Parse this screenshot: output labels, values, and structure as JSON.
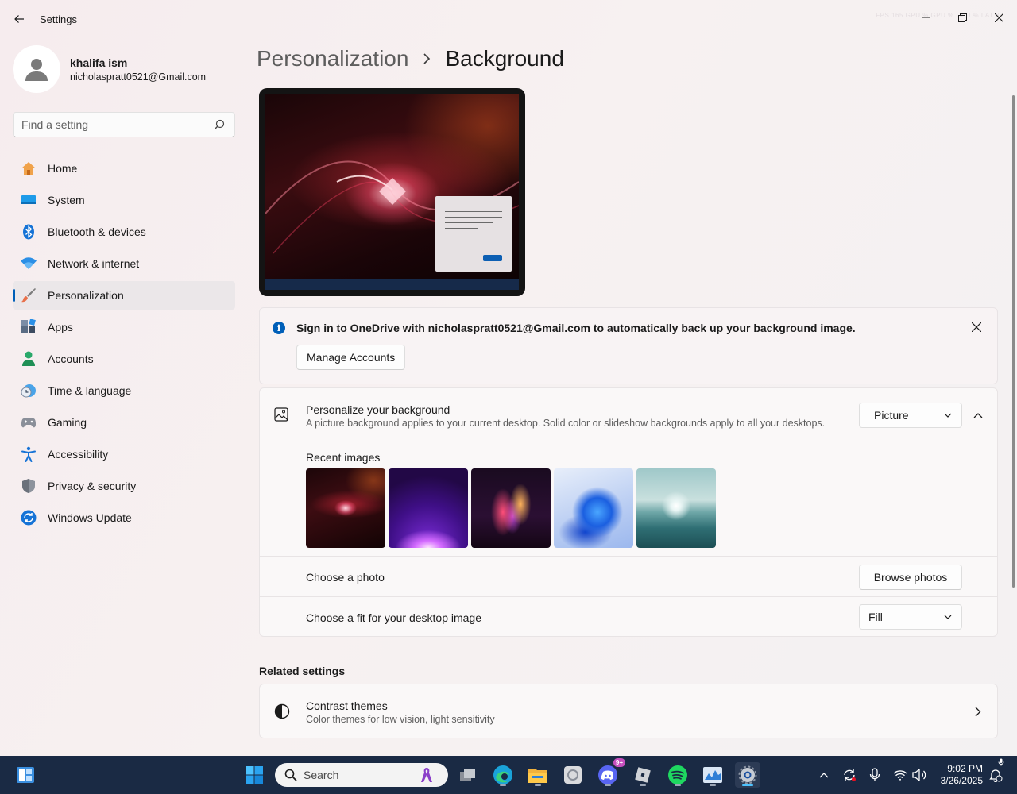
{
  "window": {
    "title": "Settings",
    "overlay": "FPS 165 GPU % GPU % CPU % LAT 8"
  },
  "profile": {
    "name": "khalifa ism",
    "email": "nicholaspratt0521@Gmail.com"
  },
  "search": {
    "placeholder": "Find a setting"
  },
  "sidebar": {
    "items": [
      {
        "label": "Home",
        "icon": "home-icon"
      },
      {
        "label": "System",
        "icon": "system-icon"
      },
      {
        "label": "Bluetooth & devices",
        "icon": "bluetooth-icon"
      },
      {
        "label": "Network & internet",
        "icon": "wifi-icon"
      },
      {
        "label": "Personalization",
        "icon": "brush-icon",
        "active": true
      },
      {
        "label": "Apps",
        "icon": "apps-icon"
      },
      {
        "label": "Accounts",
        "icon": "accounts-icon"
      },
      {
        "label": "Time & language",
        "icon": "clock-globe-icon"
      },
      {
        "label": "Gaming",
        "icon": "gamepad-icon"
      },
      {
        "label": "Accessibility",
        "icon": "accessibility-icon"
      },
      {
        "label": "Privacy & security",
        "icon": "shield-icon"
      },
      {
        "label": "Windows Update",
        "icon": "update-icon"
      }
    ]
  },
  "breadcrumb": {
    "parent": "Personalization",
    "current": "Background"
  },
  "banner": {
    "text": "Sign in to OneDrive with nicholaspratt0521@Gmail.com to automatically back up your background image.",
    "button": "Manage Accounts"
  },
  "personalize": {
    "title": "Personalize your background",
    "description": "A picture background applies to your current desktop. Solid color or slideshow backgrounds apply to all your desktops.",
    "selected": "Picture",
    "recent_label": "Recent images",
    "choose_photo": "Choose a photo",
    "browse_button": "Browse photos",
    "fit_label": "Choose a fit for your desktop image",
    "fit_selected": "Fill"
  },
  "related": {
    "title": "Related settings",
    "contrast_title": "Contrast themes",
    "contrast_desc": "Color themes for low vision, light sensitivity"
  },
  "taskbar": {
    "search_label": "Search",
    "time": "9:02 PM",
    "date": "3/26/2025",
    "discord_badge": "9+"
  },
  "colors": {
    "accent": "#005fb8",
    "taskbar": "#1a2a44"
  }
}
